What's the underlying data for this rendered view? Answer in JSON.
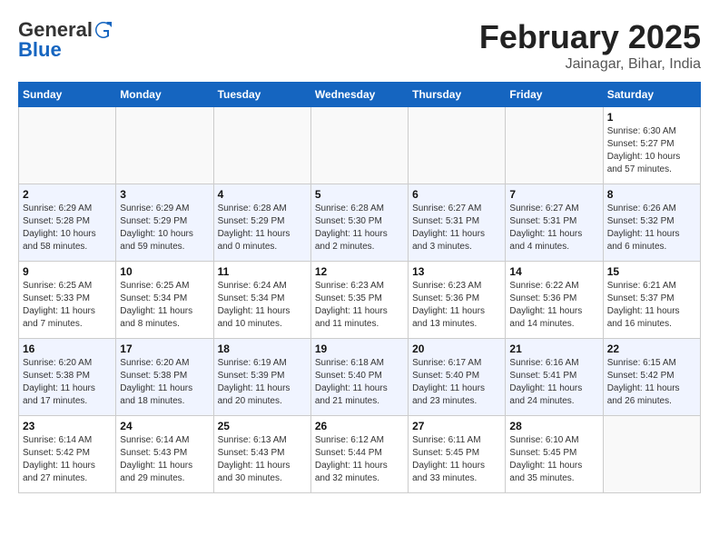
{
  "header": {
    "logo_general": "General",
    "logo_blue": "Blue",
    "title": "February 2025",
    "subtitle": "Jainagar, Bihar, India"
  },
  "weekdays": [
    "Sunday",
    "Monday",
    "Tuesday",
    "Wednesday",
    "Thursday",
    "Friday",
    "Saturday"
  ],
  "weeks": [
    [
      {
        "day": "",
        "info": ""
      },
      {
        "day": "",
        "info": ""
      },
      {
        "day": "",
        "info": ""
      },
      {
        "day": "",
        "info": ""
      },
      {
        "day": "",
        "info": ""
      },
      {
        "day": "",
        "info": ""
      },
      {
        "day": "1",
        "info": "Sunrise: 6:30 AM\nSunset: 5:27 PM\nDaylight: 10 hours\nand 57 minutes."
      }
    ],
    [
      {
        "day": "2",
        "info": "Sunrise: 6:29 AM\nSunset: 5:28 PM\nDaylight: 10 hours\nand 58 minutes."
      },
      {
        "day": "3",
        "info": "Sunrise: 6:29 AM\nSunset: 5:29 PM\nDaylight: 10 hours\nand 59 minutes."
      },
      {
        "day": "4",
        "info": "Sunrise: 6:28 AM\nSunset: 5:29 PM\nDaylight: 11 hours\nand 0 minutes."
      },
      {
        "day": "5",
        "info": "Sunrise: 6:28 AM\nSunset: 5:30 PM\nDaylight: 11 hours\nand 2 minutes."
      },
      {
        "day": "6",
        "info": "Sunrise: 6:27 AM\nSunset: 5:31 PM\nDaylight: 11 hours\nand 3 minutes."
      },
      {
        "day": "7",
        "info": "Sunrise: 6:27 AM\nSunset: 5:31 PM\nDaylight: 11 hours\nand 4 minutes."
      },
      {
        "day": "8",
        "info": "Sunrise: 6:26 AM\nSunset: 5:32 PM\nDaylight: 11 hours\nand 6 minutes."
      }
    ],
    [
      {
        "day": "9",
        "info": "Sunrise: 6:25 AM\nSunset: 5:33 PM\nDaylight: 11 hours\nand 7 minutes."
      },
      {
        "day": "10",
        "info": "Sunrise: 6:25 AM\nSunset: 5:34 PM\nDaylight: 11 hours\nand 8 minutes."
      },
      {
        "day": "11",
        "info": "Sunrise: 6:24 AM\nSunset: 5:34 PM\nDaylight: 11 hours\nand 10 minutes."
      },
      {
        "day": "12",
        "info": "Sunrise: 6:23 AM\nSunset: 5:35 PM\nDaylight: 11 hours\nand 11 minutes."
      },
      {
        "day": "13",
        "info": "Sunrise: 6:23 AM\nSunset: 5:36 PM\nDaylight: 11 hours\nand 13 minutes."
      },
      {
        "day": "14",
        "info": "Sunrise: 6:22 AM\nSunset: 5:36 PM\nDaylight: 11 hours\nand 14 minutes."
      },
      {
        "day": "15",
        "info": "Sunrise: 6:21 AM\nSunset: 5:37 PM\nDaylight: 11 hours\nand 16 minutes."
      }
    ],
    [
      {
        "day": "16",
        "info": "Sunrise: 6:20 AM\nSunset: 5:38 PM\nDaylight: 11 hours\nand 17 minutes."
      },
      {
        "day": "17",
        "info": "Sunrise: 6:20 AM\nSunset: 5:38 PM\nDaylight: 11 hours\nand 18 minutes."
      },
      {
        "day": "18",
        "info": "Sunrise: 6:19 AM\nSunset: 5:39 PM\nDaylight: 11 hours\nand 20 minutes."
      },
      {
        "day": "19",
        "info": "Sunrise: 6:18 AM\nSunset: 5:40 PM\nDaylight: 11 hours\nand 21 minutes."
      },
      {
        "day": "20",
        "info": "Sunrise: 6:17 AM\nSunset: 5:40 PM\nDaylight: 11 hours\nand 23 minutes."
      },
      {
        "day": "21",
        "info": "Sunrise: 6:16 AM\nSunset: 5:41 PM\nDaylight: 11 hours\nand 24 minutes."
      },
      {
        "day": "22",
        "info": "Sunrise: 6:15 AM\nSunset: 5:42 PM\nDaylight: 11 hours\nand 26 minutes."
      }
    ],
    [
      {
        "day": "23",
        "info": "Sunrise: 6:14 AM\nSunset: 5:42 PM\nDaylight: 11 hours\nand 27 minutes."
      },
      {
        "day": "24",
        "info": "Sunrise: 6:14 AM\nSunset: 5:43 PM\nDaylight: 11 hours\nand 29 minutes."
      },
      {
        "day": "25",
        "info": "Sunrise: 6:13 AM\nSunset: 5:43 PM\nDaylight: 11 hours\nand 30 minutes."
      },
      {
        "day": "26",
        "info": "Sunrise: 6:12 AM\nSunset: 5:44 PM\nDaylight: 11 hours\nand 32 minutes."
      },
      {
        "day": "27",
        "info": "Sunrise: 6:11 AM\nSunset: 5:45 PM\nDaylight: 11 hours\nand 33 minutes."
      },
      {
        "day": "28",
        "info": "Sunrise: 6:10 AM\nSunset: 5:45 PM\nDaylight: 11 hours\nand 35 minutes."
      },
      {
        "day": "",
        "info": ""
      }
    ]
  ]
}
